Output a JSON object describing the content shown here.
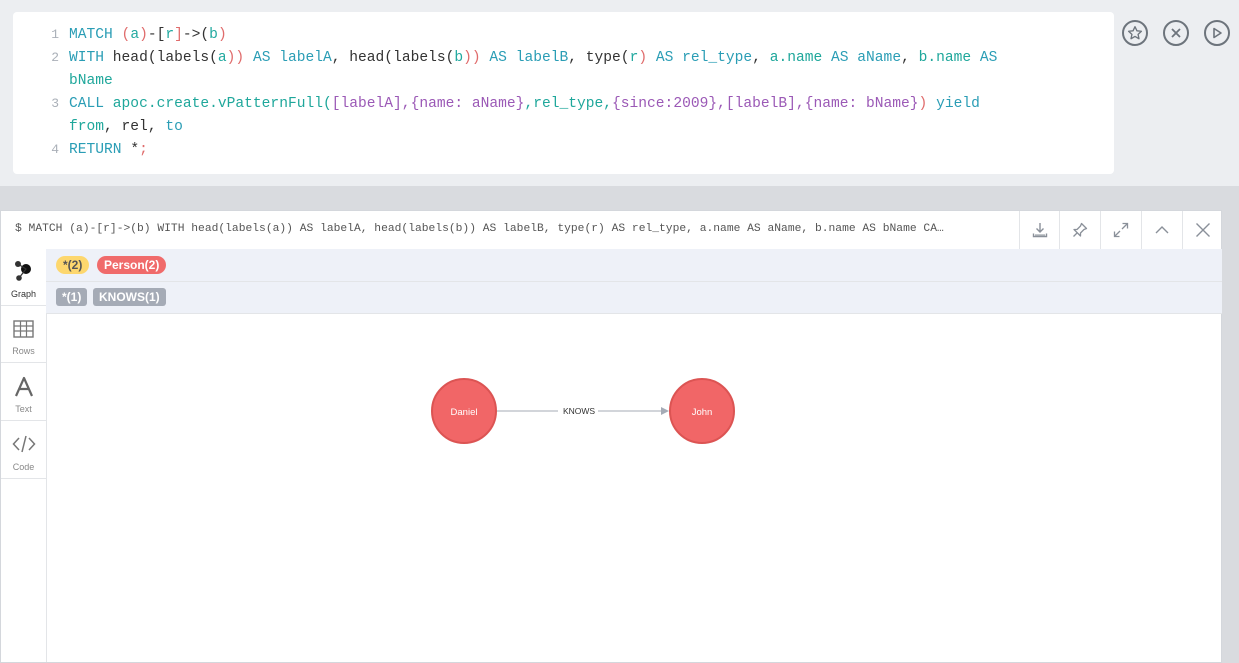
{
  "editor": {
    "lines": [
      {
        "num": "1",
        "tokens": [
          {
            "t": "MATCH ",
            "c": "kw"
          },
          {
            "t": "(",
            "c": "var"
          },
          {
            "t": "a",
            "c": "fn"
          },
          {
            "t": ")",
            "c": "var"
          },
          {
            "t": "-[",
            "c": "plain"
          },
          {
            "t": "r",
            "c": "fn"
          },
          {
            "t": "]",
            "c": "var"
          },
          {
            "t": "->(",
            "c": "plain"
          },
          {
            "t": "b",
            "c": "fn"
          },
          {
            "t": ")",
            "c": "var"
          }
        ]
      },
      {
        "num": "2",
        "tokens": [
          {
            "t": "WITH ",
            "c": "kw"
          },
          {
            "t": "head(labels(",
            "c": "plain"
          },
          {
            "t": "a",
            "c": "fn"
          },
          {
            "t": ")) ",
            "c": "var"
          },
          {
            "t": "AS labelA",
            "c": "kw"
          },
          {
            "t": ", head(labels(",
            "c": "plain"
          },
          {
            "t": "b",
            "c": "fn"
          },
          {
            "t": ")) ",
            "c": "var"
          },
          {
            "t": "AS labelB",
            "c": "kw"
          },
          {
            "t": ", type(",
            "c": "plain"
          },
          {
            "t": "r",
            "c": "fn"
          },
          {
            "t": ") ",
            "c": "var"
          },
          {
            "t": "AS rel_type",
            "c": "kw"
          },
          {
            "t": ", ",
            "c": "plain"
          },
          {
            "t": "a.name ",
            "c": "teal"
          },
          {
            "t": "AS aName",
            "c": "kw"
          },
          {
            "t": ", ",
            "c": "plain"
          },
          {
            "t": "b.name ",
            "c": "teal"
          },
          {
            "t": "AS",
            "c": "kw"
          }
        ]
      },
      {
        "num": "",
        "tokens": [
          {
            "t": "bName",
            "c": "teal"
          }
        ]
      },
      {
        "num": "3",
        "tokens": [
          {
            "t": "CALL ",
            "c": "kw"
          },
          {
            "t": "apoc.create.vPatternFull(",
            "c": "teal"
          },
          {
            "t": "[labelA],",
            "c": "str"
          },
          {
            "t": "{name: aName}",
            "c": "str"
          },
          {
            "t": ",rel_type,",
            "c": "teal"
          },
          {
            "t": "{since:2009}",
            "c": "str"
          },
          {
            "t": ",[labelB],",
            "c": "str"
          },
          {
            "t": "{name: bName}",
            "c": "str"
          },
          {
            "t": ") ",
            "c": "var"
          },
          {
            "t": "yield",
            "c": "kw"
          }
        ]
      },
      {
        "num": "",
        "tokens": [
          {
            "t": "from",
            "c": "teal"
          },
          {
            "t": ", rel, ",
            "c": "plain"
          },
          {
            "t": "to",
            "c": "kw"
          }
        ]
      },
      {
        "num": "4",
        "tokens": [
          {
            "t": "RETURN ",
            "c": "kw"
          },
          {
            "t": "*",
            "c": "plain"
          },
          {
            "t": ";",
            "c": "var"
          }
        ]
      }
    ]
  },
  "editor_actions": [
    "star-icon",
    "close-circle-icon",
    "play-icon"
  ],
  "frame": {
    "query_summary": "$ MATCH (a)-[r]->(b) WITH head(labels(a)) AS labelA, head(labels(b)) AS labelB, type(r) AS rel_type, a.name AS aName, b.name AS bName CA…",
    "header_buttons": [
      "download-icon",
      "pin-icon",
      "expand-icon",
      "collapse-up-icon",
      "close-icon"
    ]
  },
  "sidebar": {
    "items": [
      {
        "label": "Graph",
        "icon": "graph-icon",
        "active": true
      },
      {
        "label": "Rows",
        "icon": "table-icon",
        "active": false
      },
      {
        "label": "Text",
        "icon": "text-icon",
        "active": false
      },
      {
        "label": "Code",
        "icon": "code-icon",
        "active": false
      }
    ]
  },
  "legend": {
    "node_all": "*(2)",
    "node_person": "Person(2)",
    "rel_all": "*(1)",
    "rel_knows": "KNOWS(1)",
    "colors": {
      "node_all": "#fdd76e",
      "person": "#f06b6b"
    }
  },
  "graph": {
    "nodes": [
      {
        "id": "daniel",
        "label": "Daniel"
      },
      {
        "id": "john",
        "label": "John"
      }
    ],
    "relationship": {
      "from": "daniel",
      "to": "john",
      "type": "KNOWS"
    },
    "node_color": "#f16667",
    "node_stroke": "#dc5453"
  }
}
